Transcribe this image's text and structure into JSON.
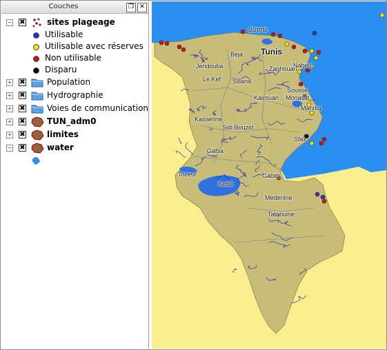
{
  "panel": {
    "title": "Couches",
    "float_glyph": "❐",
    "close_glyph": "✕"
  },
  "legend": {
    "group": {
      "label": "sites plageage",
      "expand_glyph": "−",
      "checked_glyph": "✖",
      "icon": "multi-dot-point-icon",
      "classes": [
        {
          "label": "Utilisable",
          "color": "#3b2fb8"
        },
        {
          "label": "Utilisable avec réserves",
          "color": "#f2e600"
        },
        {
          "label": "Non utilisable",
          "color": "#cc1111"
        },
        {
          "label": "Disparu",
          "color": "#000000"
        }
      ]
    },
    "layers": [
      {
        "label": "Population",
        "bold": false,
        "icon": "folder-icon"
      },
      {
        "label": "Hydrographie",
        "bold": false,
        "icon": "folder-icon"
      },
      {
        "label": "Voies de communication",
        "bold": false,
        "icon": "folder-icon"
      },
      {
        "label": "TUN_adm0",
        "bold": true,
        "icon": "polygon-layer-icon"
      },
      {
        "label": "limites",
        "bold": true,
        "icon": "polygon-layer-icon"
      },
      {
        "label": "water",
        "bold": true,
        "icon": "polygon-layer-icon"
      }
    ],
    "expand_glyph": "+",
    "collapse_glyph": "−",
    "checked_glyph": "✖"
  },
  "colors": {
    "sea": "#2a8ff0",
    "land": "#c8bd78",
    "background": "#fbee8e",
    "river": "#2233aa",
    "lake": "#3070e0"
  },
  "map": {
    "places": [
      {
        "name": "Bizerte",
        "big": false
      },
      {
        "name": "Beja",
        "big": false
      },
      {
        "name": "Tunis",
        "big": true
      },
      {
        "name": "Jendouba",
        "big": false
      },
      {
        "name": "Zaghouan",
        "big": false
      },
      {
        "name": "Nabeul",
        "big": false
      },
      {
        "name": "Le Kef",
        "big": false
      },
      {
        "name": "Siliana",
        "big": false
      },
      {
        "name": "Sousse",
        "big": false
      },
      {
        "name": "Kairouan",
        "big": false
      },
      {
        "name": "Monastir",
        "big": false
      },
      {
        "name": "Mahdia",
        "big": false
      },
      {
        "name": "Kasserine",
        "big": false
      },
      {
        "name": "Sidi Bouzid",
        "big": false
      },
      {
        "name": "Sfax",
        "big": false
      },
      {
        "name": "Gafsa",
        "big": false
      },
      {
        "name": "Tozeur",
        "big": false
      },
      {
        "name": "Kebili",
        "big": false
      },
      {
        "name": "Gabes",
        "big": false
      },
      {
        "name": "Medenine",
        "big": false
      },
      {
        "name": "Tataouine",
        "big": false
      }
    ]
  }
}
